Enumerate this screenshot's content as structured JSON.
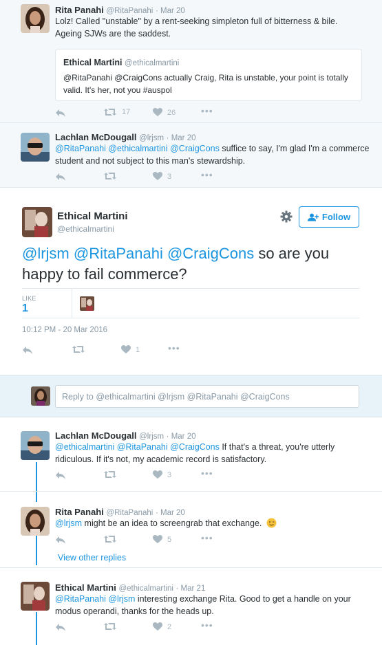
{
  "tweets_above": [
    {
      "name": "Rita Panahi",
      "handle": "@RitaPanahi",
      "time": "· Mar 20",
      "lines": [
        "Lolz! Called \"unstable\" by a rent-seeking simpleton full of bitterness & bile.",
        "Ageing SJWs are the saddest."
      ],
      "quote": {
        "name": "Ethical Martini",
        "handle": "@ethicalmartini",
        "line1": "@RitaPanahi @CraigCons actually Craig, Rita is unstable, your point is totally",
        "line2": "valid. It's her, not you #auspol"
      },
      "retweets": "17",
      "likes": "26"
    },
    {
      "name": "Lachlan McDougall",
      "handle": "@lrjsm",
      "time": "· Mar 20",
      "mentions": "@RitaPanahi @ethicalmartini @CraigCons",
      "line1_rest": " suffice to say, I'm glad I'm a commerce",
      "line2": "student and not subject to this man's stewardship.",
      "retweets": "",
      "likes": "3"
    }
  ],
  "main_tweet": {
    "name": "Ethical Martini",
    "handle": "@ethicalmartini",
    "follow_label": "Follow",
    "mentions": "@lrjsm @RitaPanahi @CraigCons",
    "line1_rest": " so are you",
    "line2": "happy to fail commerce?",
    "like_label": "LIKE",
    "like_count": "1",
    "timestamp": "10:12 PM - 20 Mar 2016",
    "likes": "1"
  },
  "reply_box": {
    "placeholder": "Reply to @ethicalmartini @lrjsm @RitaPanahi @CraigCons"
  },
  "replies": [
    {
      "name": "Lachlan McDougall",
      "handle": "@lrjsm",
      "time": "· Mar 20",
      "mentions": "@ethicalmartini @RitaPanahi @CraigCons",
      "line1_rest": " If that's a threat, you're utterly",
      "line2": "ridiculous. If it's not, my academic record is satisfactory.",
      "likes": "3"
    },
    {
      "name": "Rita Panahi",
      "handle": "@RitaPanahi",
      "time": "· Mar 20",
      "mentions": "@lrjsm",
      "line1_rest": " might be an idea to screengrab that exchange.",
      "likes": "5",
      "view_other": "View other replies"
    },
    {
      "name": "Ethical Martini",
      "handle": "@ethicalmartini",
      "time": "· Mar 21",
      "mentions": "@RitaPanahi @lrjsm",
      "line1_rest": " interesting exchange Rita. Good to get a handle on your",
      "line2": "modus operandi, thanks for the heads up.",
      "likes": "2"
    }
  ],
  "colors": {
    "link": "#1b95e0",
    "muted": "#8899a6",
    "icon": "#aab8c2",
    "grey_bg": "#f5f8fa"
  }
}
